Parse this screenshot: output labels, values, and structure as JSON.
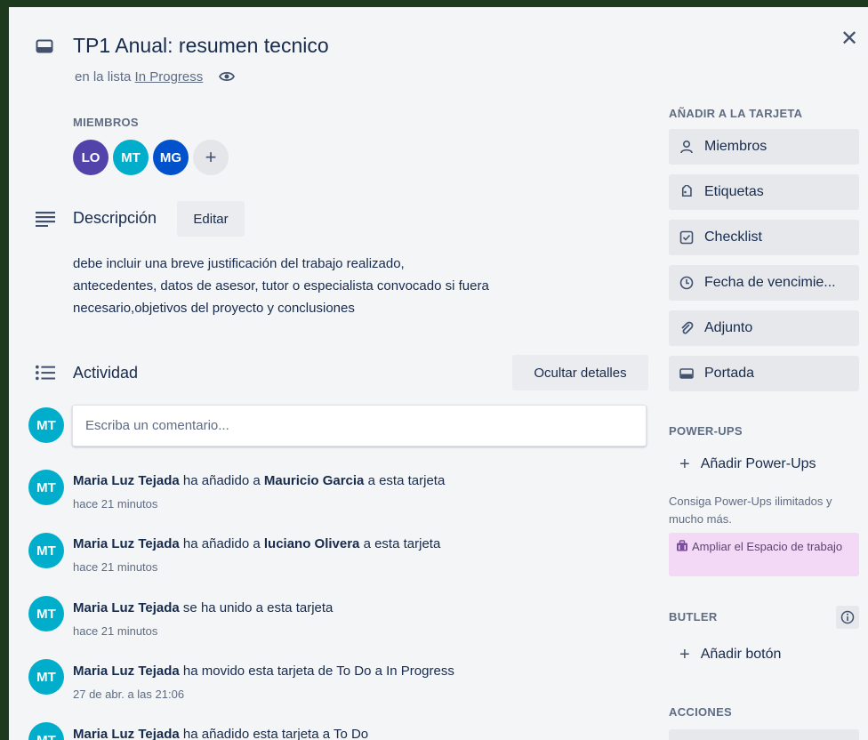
{
  "card": {
    "title": "TP1 Anual: resumen tecnico",
    "in_list_prefix": "en la lista",
    "list_name": "In Progress"
  },
  "members": {
    "label": "MIEMBROS",
    "avatars": [
      {
        "initials": "LO",
        "color": "#5243aa"
      },
      {
        "initials": "MT",
        "color": "#00aecc"
      },
      {
        "initials": "MG",
        "color": "#0052cc"
      }
    ],
    "add_symbol": "+"
  },
  "description": {
    "title": "Descripción",
    "edit_label": "Editar",
    "lines": [
      "debe incluir una breve justificación del trabajo realizado,",
      "antecedentes, datos de asesor, tutor o especialista convocado si fuera",
      "necesario,objetivos del proyecto y conclusiones"
    ]
  },
  "activity": {
    "title": "Actividad",
    "toggle_details_label": "Ocultar detalles",
    "current_user_initials": "MT",
    "comment_placeholder": "Escriba un comentario...",
    "items": [
      {
        "initials": "MT",
        "user": "Maria Luz Tejada",
        "action": " ha añadido a ",
        "target": "Mauricio Garcia",
        "suffix": " a esta tarjeta",
        "time": "hace 21 minutos"
      },
      {
        "initials": "MT",
        "user": "Maria Luz Tejada",
        "action": " ha añadido a ",
        "target": "luciano Olivera",
        "suffix": " a esta tarjeta",
        "time": "hace 21 minutos"
      },
      {
        "initials": "MT",
        "user": "Maria Luz Tejada",
        "action": " se ha unido a esta tarjeta",
        "target": "",
        "suffix": "",
        "time": "hace 21 minutos"
      },
      {
        "initials": "MT",
        "user": "Maria Luz Tejada",
        "action": " ha movido esta tarjeta de To Do a In Progress",
        "target": "",
        "suffix": "",
        "time": "27 de abr. a las 21:06"
      },
      {
        "initials": "MT",
        "user": "Maria Luz Tejada",
        "action": " ha añadido esta tarjeta a To Do",
        "target": "",
        "suffix": "",
        "time": ""
      }
    ]
  },
  "sidebar": {
    "add_to_card_label": "AÑADIR A LA TARJETA",
    "add_buttons": [
      {
        "label": "Miembros",
        "icon": "person-icon"
      },
      {
        "label": "Etiquetas",
        "icon": "tag-icon"
      },
      {
        "label": "Checklist",
        "icon": "checklist-icon"
      },
      {
        "label": "Fecha de vencimie...",
        "icon": "clock-icon"
      },
      {
        "label": "Adjunto",
        "icon": "paperclip-icon"
      },
      {
        "label": "Portada",
        "icon": "cover-icon"
      }
    ],
    "powerups_label": "POWER-UPS",
    "add_powerups_label": "Añadir Power-Ups",
    "powerups_note": "Consiga Power-Ups ilimitados y mucho más.",
    "upgrade_label": "Ampliar el Espacio de trabajo",
    "butler_label": "BUTLER",
    "add_button_label": "Añadir botón",
    "actions_label": "ACCIONES"
  },
  "colors": {
    "accent": "#0079bf",
    "avatar_mt": "#00aecc",
    "upgrade_bg": "#f3d9f6"
  }
}
